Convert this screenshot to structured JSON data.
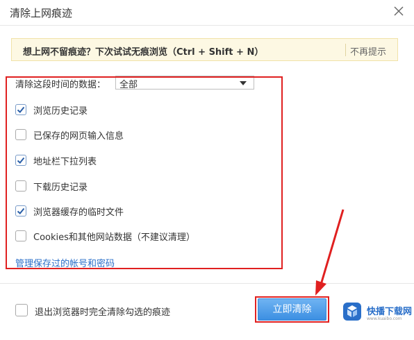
{
  "dialog": {
    "title": "清除上网痕迹"
  },
  "tip": {
    "text": "想上网不留痕迹？下次试试无痕浏览（Ctrl + Shift + N）",
    "dismiss": "不再提示"
  },
  "range": {
    "label": "清除这段时间的数据：",
    "selected": "全部"
  },
  "options": [
    {
      "label": "浏览历史记录",
      "checked": true
    },
    {
      "label": "已保存的网页输入信息",
      "checked": false
    },
    {
      "label": "地址栏下拉列表",
      "checked": true
    },
    {
      "label": "下载历史记录",
      "checked": false
    },
    {
      "label": "浏览器缓存的临时文件",
      "checked": true
    },
    {
      "label": "Cookies和其他网站数据（不建议清理）",
      "checked": false
    }
  ],
  "manage_link": "管理保存过的帐号和密码",
  "footer": {
    "exit_clear_label": "退出浏览器时完全清除勾选的痕迹",
    "exit_clear_checked": false,
    "clear_button": "立即清除"
  },
  "watermark": {
    "name": "快播下载网",
    "sub": "www.kuaibo.com"
  },
  "colors": {
    "accent": "#3c8fe2",
    "annotation_red": "#e02020",
    "tip_bg": "#fdf8e3"
  }
}
